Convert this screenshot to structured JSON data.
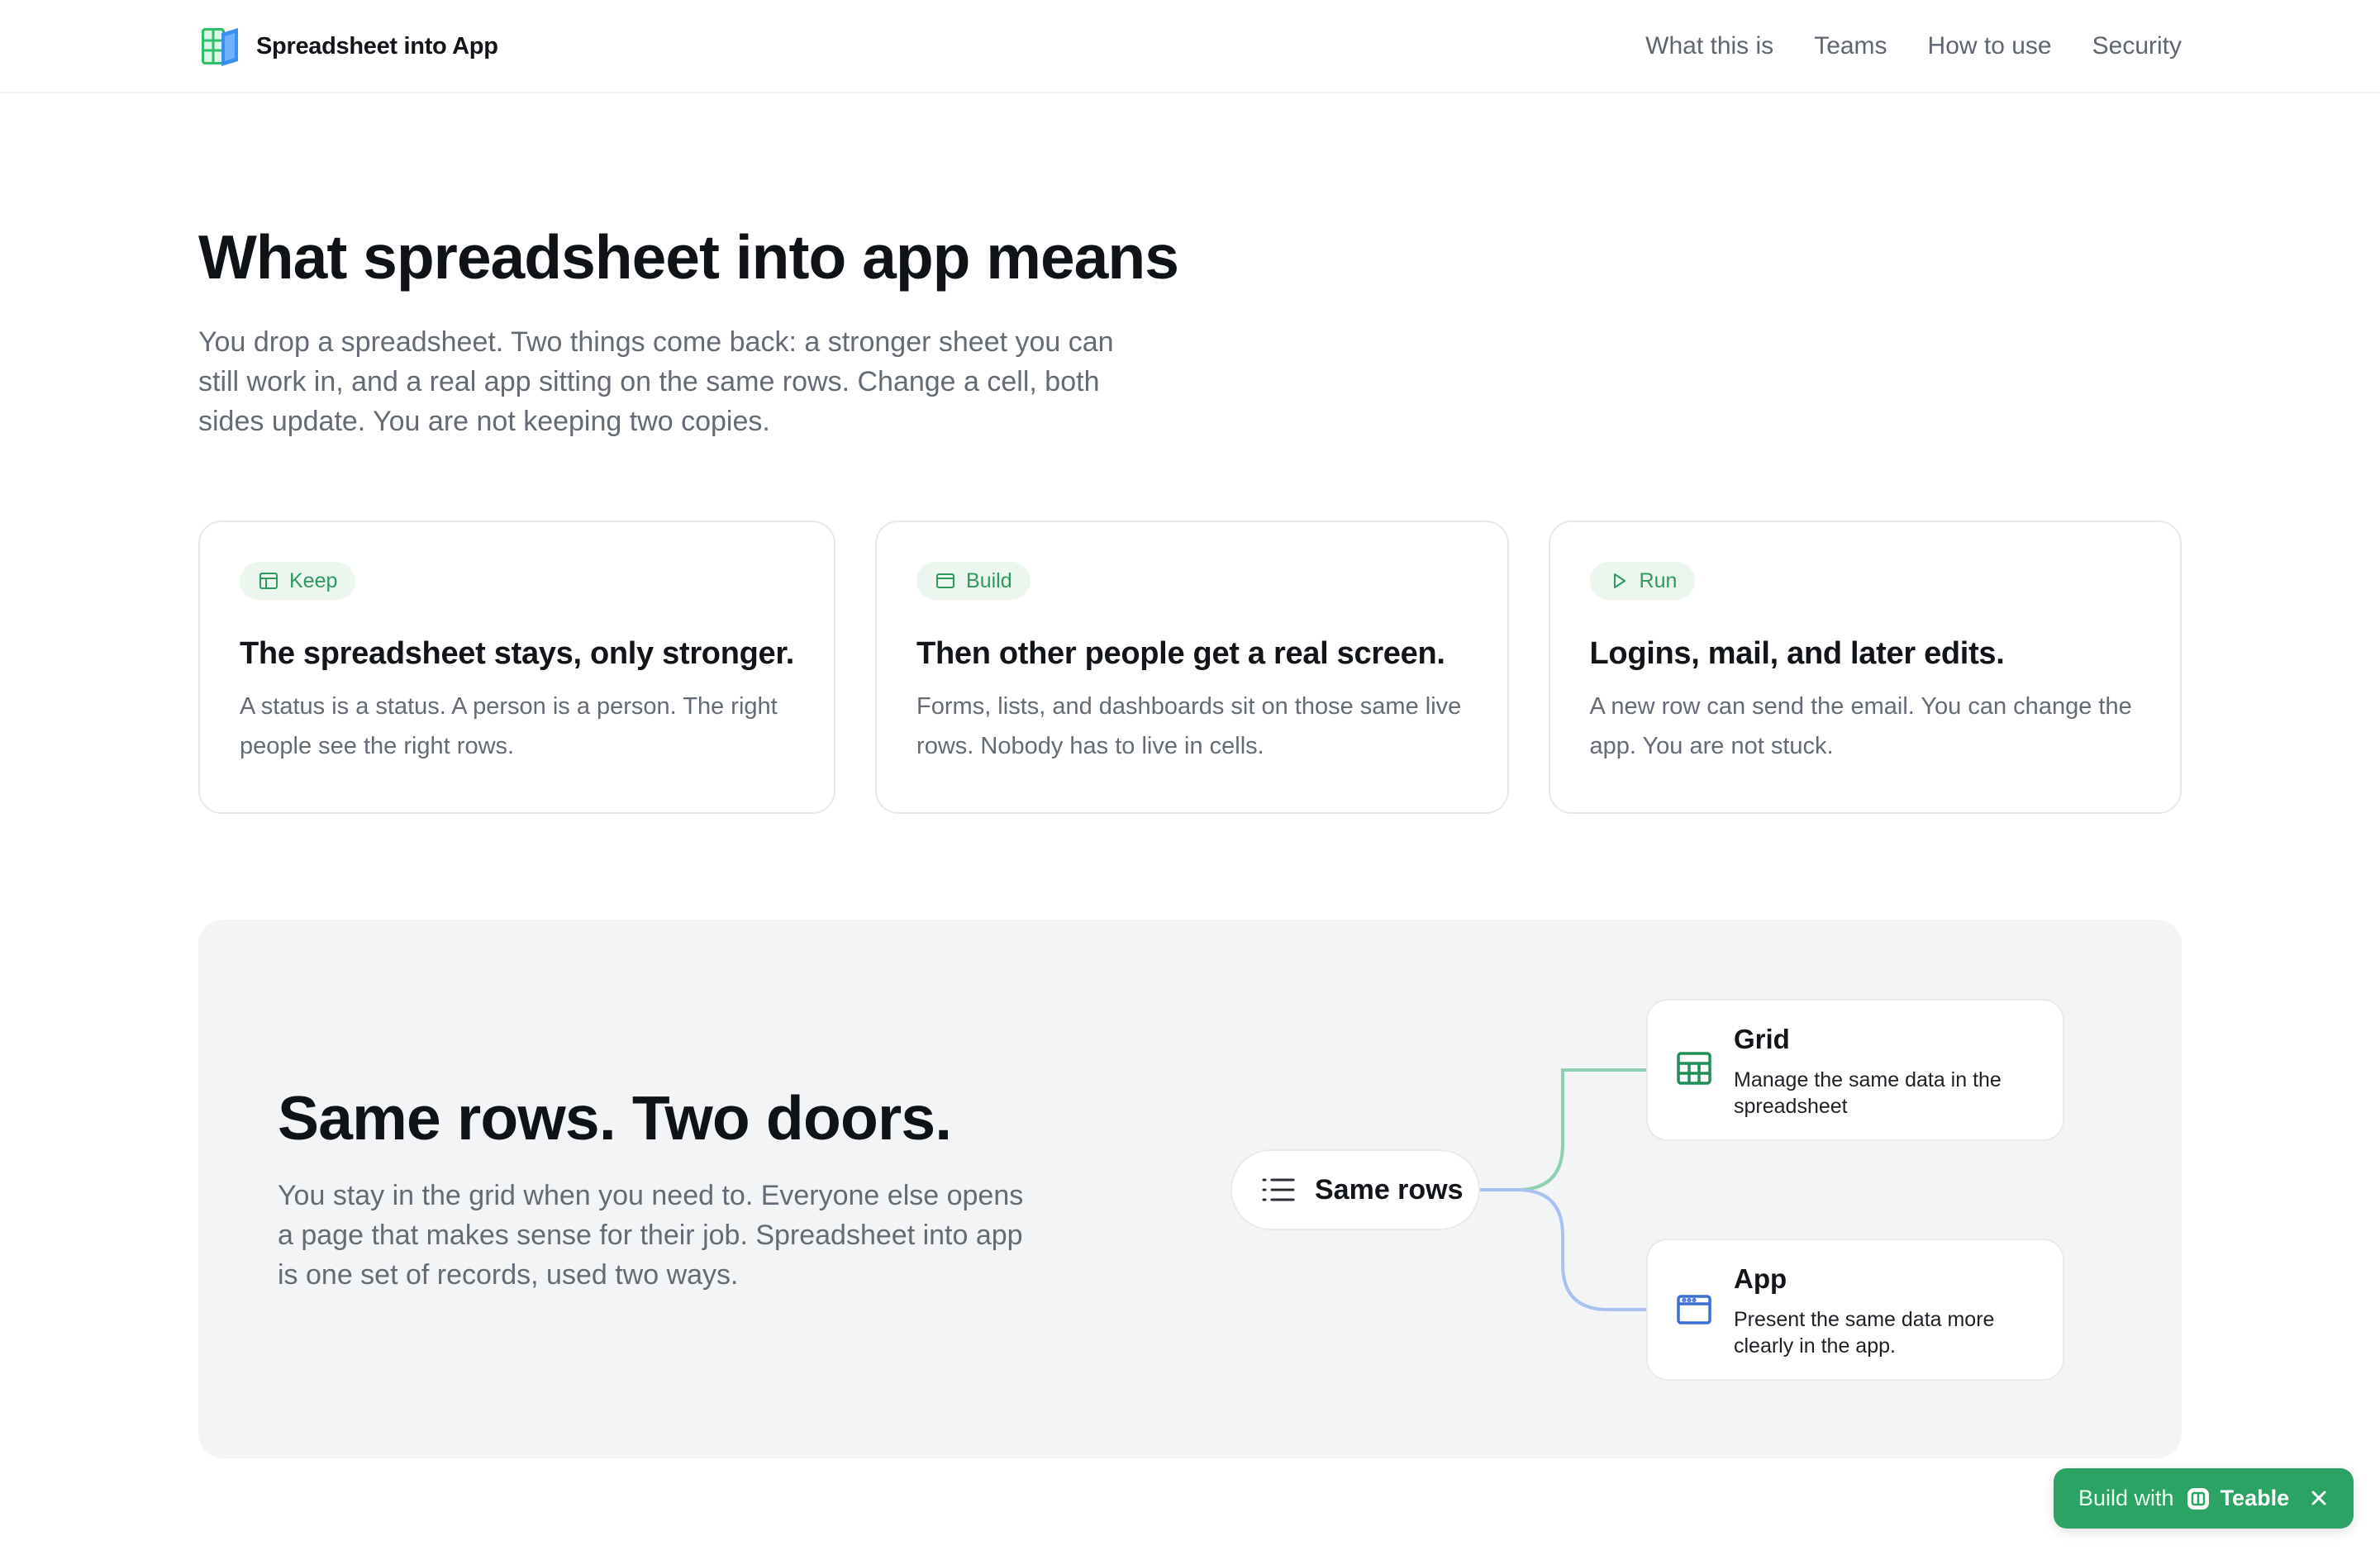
{
  "header": {
    "brand_name": "Spreadsheet into App",
    "logo_icon": "spreadsheet-app-logo-icon",
    "nav": [
      "What this is",
      "Teams",
      "How to use",
      "Security"
    ]
  },
  "intro": {
    "title": "What spreadsheet into app means",
    "lead": "You drop a spreadsheet. Two things come back: a stronger sheet you can still work in, and a real app sitting on the same rows. Change a cell, both sides update. You are not keeping two copies."
  },
  "cards": [
    {
      "tag": "Keep",
      "tag_icon": "table-icon",
      "title": "The spreadsheet stays, only stronger.",
      "body": "A status is a status. A person is a person. The right people see the right rows."
    },
    {
      "tag": "Build",
      "tag_icon": "window-icon",
      "title": "Then other people get a real screen.",
      "body": "Forms, lists, and dashboards sit on those same live rows. Nobody has to live in cells."
    },
    {
      "tag": "Run",
      "tag_icon": "play-icon",
      "title": "Logins, mail, and later edits.",
      "body": "A new row can send the email. You can change the app. You are not stuck."
    }
  ],
  "panel": {
    "title": "Same rows. Two doors.",
    "body": "You stay in the grid when you need to. Everyone else opens a page that makes sense for their job. Spreadsheet into app is one set of records, used two ways.",
    "source": {
      "label": "Same rows",
      "icon": "list-icon"
    },
    "targets": [
      {
        "title": "Grid",
        "desc": "Manage the same data in the spreadsheet",
        "icon": "grid-icon",
        "color": "#1f8f55"
      },
      {
        "title": "App",
        "desc": "Present the same data more clearly in the app.",
        "icon": "app-window-icon",
        "color": "#3b6fd6"
      }
    ],
    "colors": {
      "grid_wire": "#8fd0b0",
      "app_wire": "#a9c1ee"
    }
  },
  "badge": {
    "prefix": "Build with",
    "brand": "Teable",
    "logo_icon": "teable-logo-icon",
    "close_icon": "close-icon",
    "color": "#2aa365"
  }
}
